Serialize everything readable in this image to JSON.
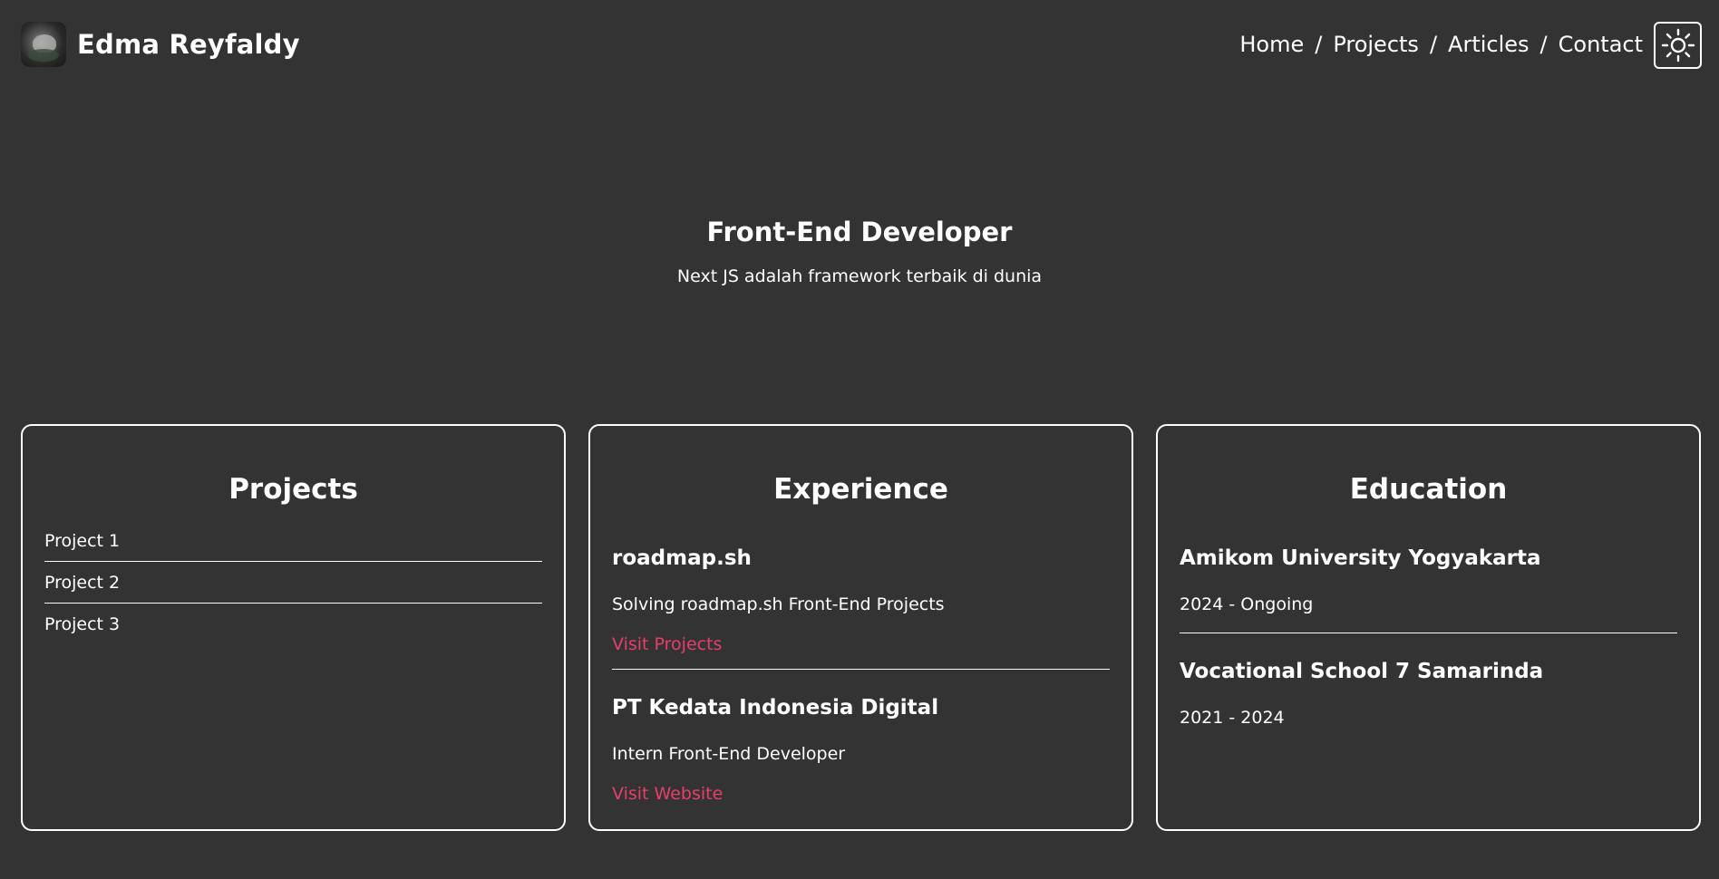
{
  "header": {
    "name": "Edma Reyfaldy",
    "nav": [
      "Home",
      "Projects",
      "Articles",
      "Contact"
    ],
    "separator": "/",
    "theme_icon": "sun-icon"
  },
  "hero": {
    "title": "Front-End Developer",
    "subtitle": "Next JS adalah framework terbaik di dunia"
  },
  "projects": {
    "title": "Projects",
    "items": [
      "Project 1",
      "Project 2",
      "Project 3"
    ]
  },
  "experience": {
    "title": "Experience",
    "items": [
      {
        "company": "roadmap.sh",
        "description": "Solving roadmap.sh Front-End Projects",
        "link": "Visit Projects"
      },
      {
        "company": "PT Kedata Indonesia Digital",
        "description": "Intern Front-End Developer",
        "link": "Visit Website"
      }
    ]
  },
  "education": {
    "title": "Education",
    "items": [
      {
        "school": "Amikom University Yogyakarta",
        "period": "2024 - Ongoing"
      },
      {
        "school": "Vocational School 7 Samarinda",
        "period": "2021 - 2024"
      }
    ]
  },
  "colors": {
    "background": "#333333",
    "text": "#ffffff",
    "accent_link": "#e83e6c"
  }
}
